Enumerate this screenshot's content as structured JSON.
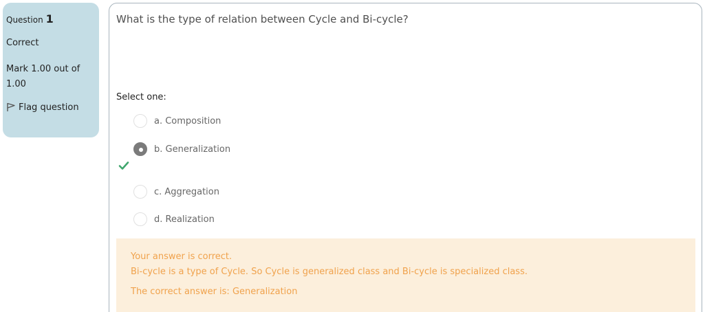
{
  "info": {
    "question_label": "Question",
    "question_number": "1",
    "state": "Correct",
    "grade": "Mark 1.00 out of 1.00",
    "flag_label": "Flag question"
  },
  "question": {
    "text": "What is the type of relation between Cycle and Bi-cycle?",
    "prompt": "Select one:",
    "options": [
      {
        "label": "a. Composition",
        "selected": false
      },
      {
        "label": "b. Generalization",
        "selected": true
      },
      {
        "label": "c. Aggregation",
        "selected": false
      },
      {
        "label": "d. Realization",
        "selected": false
      }
    ]
  },
  "feedback": {
    "status": "Your answer is correct.",
    "general": "Bi-cycle is a type of Cycle. So Cycle is generalized class and Bi-cycle is specialized class.",
    "right_answer": "The correct answer is: Generalization"
  },
  "colors": {
    "info_bg": "#c4dde5",
    "feedback_bg": "#fcefdc",
    "feedback_text": "#f0a24c",
    "correct_check": "#3fa66d"
  },
  "icons": {
    "flag": "flag-outline-icon",
    "correct": "check-icon"
  }
}
